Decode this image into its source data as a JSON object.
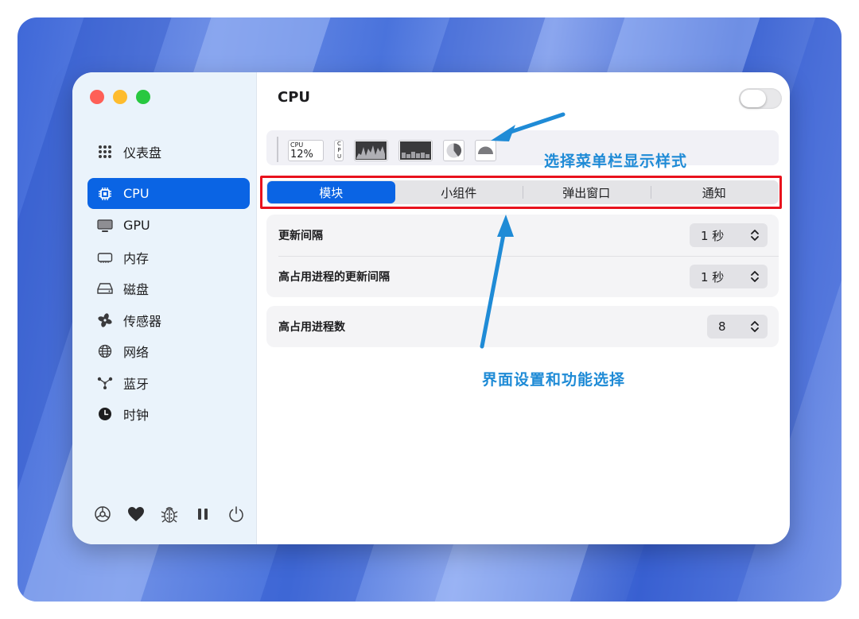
{
  "sidebar": {
    "items": [
      {
        "label": "仪表盘",
        "icon": "grid-icon"
      },
      {
        "label": "CPU",
        "icon": "chip-icon",
        "active": true
      },
      {
        "label": "GPU",
        "icon": "monitor-icon"
      },
      {
        "label": "内存",
        "icon": "memory-icon"
      },
      {
        "label": "磁盘",
        "icon": "disk-icon"
      },
      {
        "label": "传感器",
        "icon": "fan-icon"
      },
      {
        "label": "网络",
        "icon": "globe-icon"
      },
      {
        "label": "蓝牙",
        "icon": "bluetooth-nodes-icon"
      },
      {
        "label": "时钟",
        "icon": "clock-icon"
      }
    ],
    "footer_icons": [
      "settings-icon",
      "heart-icon",
      "bug-icon",
      "pause-icon",
      "power-icon"
    ]
  },
  "main": {
    "title": "CPU",
    "enabled": false,
    "preview": {
      "mini_label": "CPU",
      "mini_value": "12%",
      "label_letters": [
        "C",
        "P",
        "U"
      ]
    },
    "tabs": [
      {
        "label": "模块",
        "active": true
      },
      {
        "label": "小组件",
        "active": false
      },
      {
        "label": "弹出窗口",
        "active": false
      },
      {
        "label": "通知",
        "active": false
      }
    ],
    "settings": {
      "update_interval_label": "更新间隔",
      "update_interval_value": "1 秒",
      "top_proc_interval_label": "高占用进程的更新间隔",
      "top_proc_interval_value": "1 秒",
      "top_proc_count_label": "高占用进程数",
      "top_proc_count_value": "8"
    }
  },
  "annotations": {
    "menu_bar_style": "选择菜单栏显示样式",
    "interface_settings": "界面设置和功能选择"
  },
  "colors": {
    "accent": "#0a64e4",
    "highlight_box": "#e8121d",
    "annotation": "#1f8bd6",
    "close": "#fe5f57",
    "minimize": "#febc2e",
    "zoom": "#28c840"
  }
}
